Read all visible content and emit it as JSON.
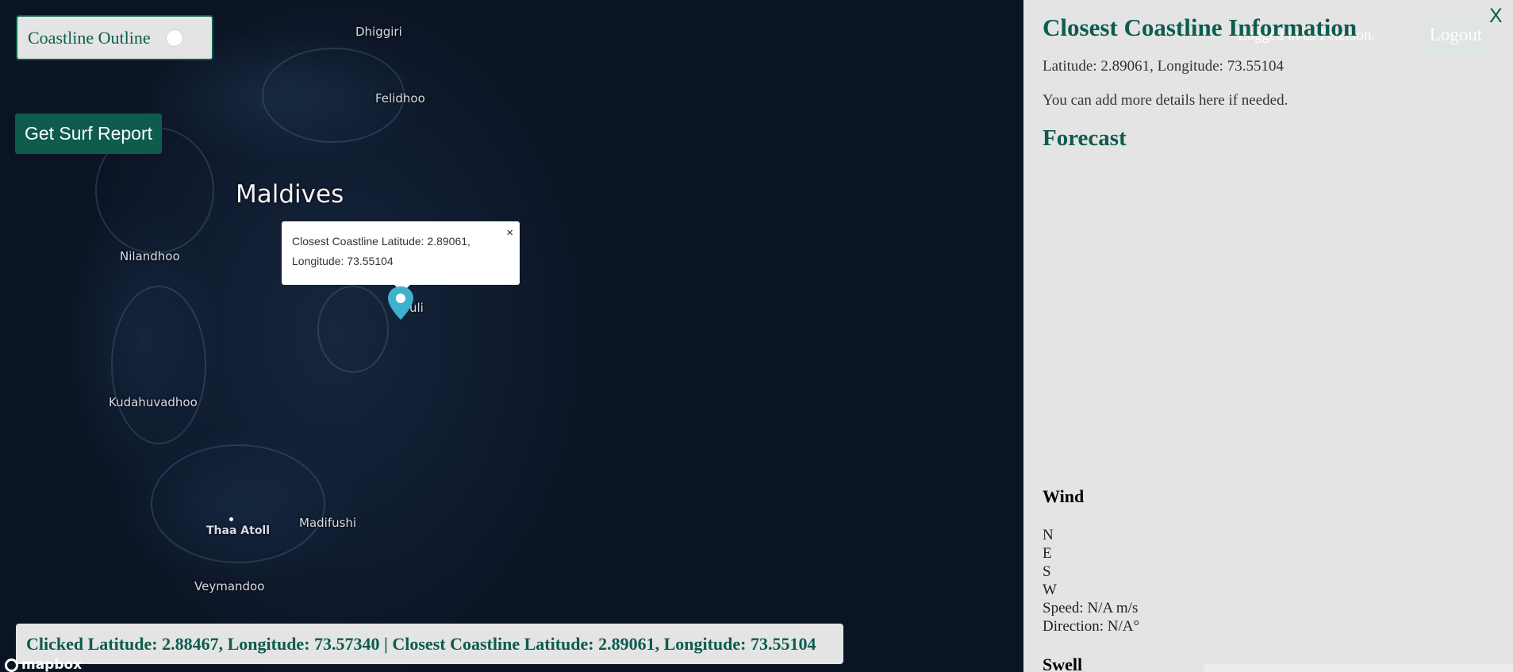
{
  "map": {
    "places": [
      {
        "name": "Dhiggiri"
      },
      {
        "name": "Felidhoo"
      },
      {
        "name": "Maldives"
      },
      {
        "name": "Nilandhoo"
      },
      {
        "name": "Kudahuvadhoo"
      },
      {
        "name": "Thaa Atoll"
      },
      {
        "name": "Madifushi"
      },
      {
        "name": "Veymandoo"
      },
      {
        "name": "uli"
      }
    ],
    "coastline_toggle": {
      "label": "Coastline Outline",
      "enabled": false
    },
    "surf_button": {
      "label": "Get Surf Report"
    },
    "popup": {
      "text": "Closest Coastline Latitude: 2.89061, Longitude: 73.55104",
      "close_label": "×"
    },
    "bottom_bar": {
      "text": "Clicked Latitude: 2.88467, Longitude: 73.57340 | Closest Coastline Latitude: 2.89061, Longitude: 73.55104"
    },
    "attribution": "mapbox",
    "marker_color": "#3fb1ce"
  },
  "panel": {
    "title": "Closest Coastline Information",
    "logged_in_text": "Logged in as Peterson.",
    "logout_label": "Logout",
    "close_label": "X",
    "coords": "Latitude: 2.89061, Longitude: 73.55104",
    "details": "You can add more details here if needed.",
    "forecast_title": "Forecast",
    "wind": {
      "title": "Wind",
      "directions": [
        "N",
        "E",
        "S",
        "W"
      ],
      "speed": "Speed: N/A m/s",
      "direction": "Direction: N/A°"
    },
    "swell_title": "Swell"
  },
  "colors": {
    "accent": "#0d5c4e",
    "panel_bg": "#e4e4e4",
    "map_bg": "#0b1220"
  }
}
